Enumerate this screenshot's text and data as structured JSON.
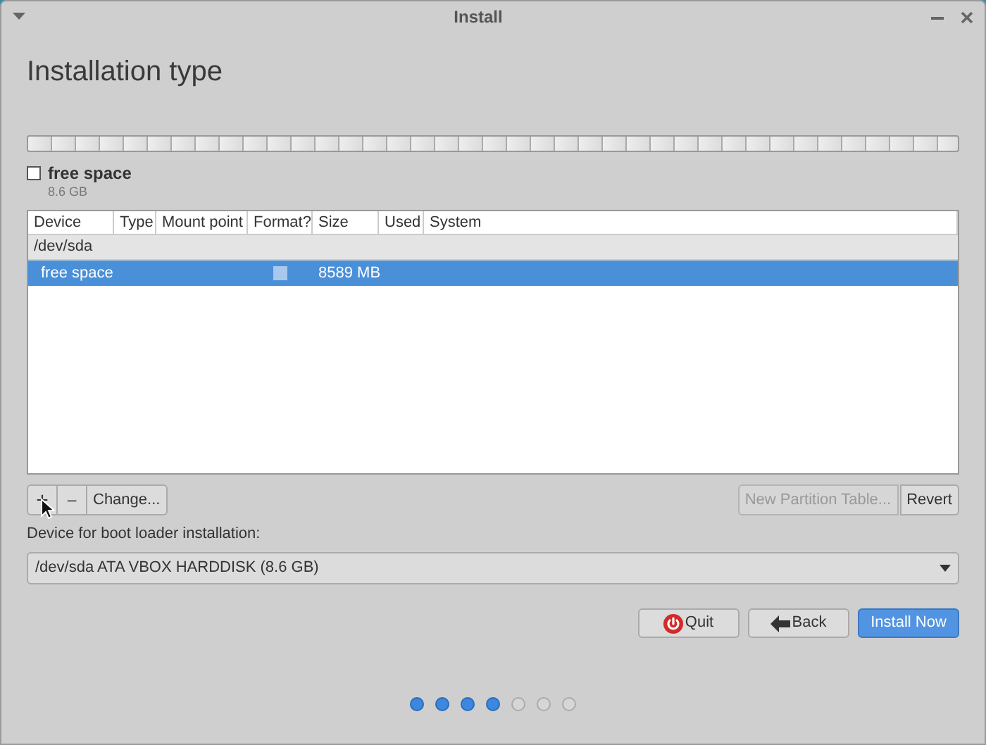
{
  "window": {
    "title": "Install"
  },
  "page_title": "Installation type",
  "disk_legend": {
    "label": "free space",
    "size": "8.6 GB",
    "checked": false
  },
  "table": {
    "columns": [
      "Device",
      "Type",
      "Mount point",
      "Format?",
      "Size",
      "Used",
      "System"
    ],
    "rows": [
      {
        "kind": "device",
        "device": "/dev/sda",
        "selected": false
      },
      {
        "kind": "partition",
        "device": "free space",
        "type": "",
        "mount_point": "",
        "format": false,
        "size": "8589 MB",
        "used": "",
        "system": "",
        "selected": true
      }
    ]
  },
  "partition_buttons": {
    "add": "+",
    "remove": "−",
    "change": "Change...",
    "new_table": {
      "label": "New Partition Table...",
      "disabled": true
    },
    "revert": {
      "label": "Revert",
      "disabled": false
    }
  },
  "boot_loader": {
    "label": "Device for boot loader installation:",
    "value": "/dev/sda ATA VBOX HARDDISK (8.6 GB)"
  },
  "buttons": [
    {
      "kind": "quit",
      "label": "Quit"
    },
    {
      "kind": "back",
      "label": "Back"
    },
    {
      "kind": "primary",
      "label": "Install Now"
    }
  ],
  "steps": [
    {
      "completed": true
    },
    {
      "completed": true
    },
    {
      "completed": true
    },
    {
      "completed": true
    },
    {
      "completed": false
    },
    {
      "completed": false
    },
    {
      "completed": false
    }
  ]
}
